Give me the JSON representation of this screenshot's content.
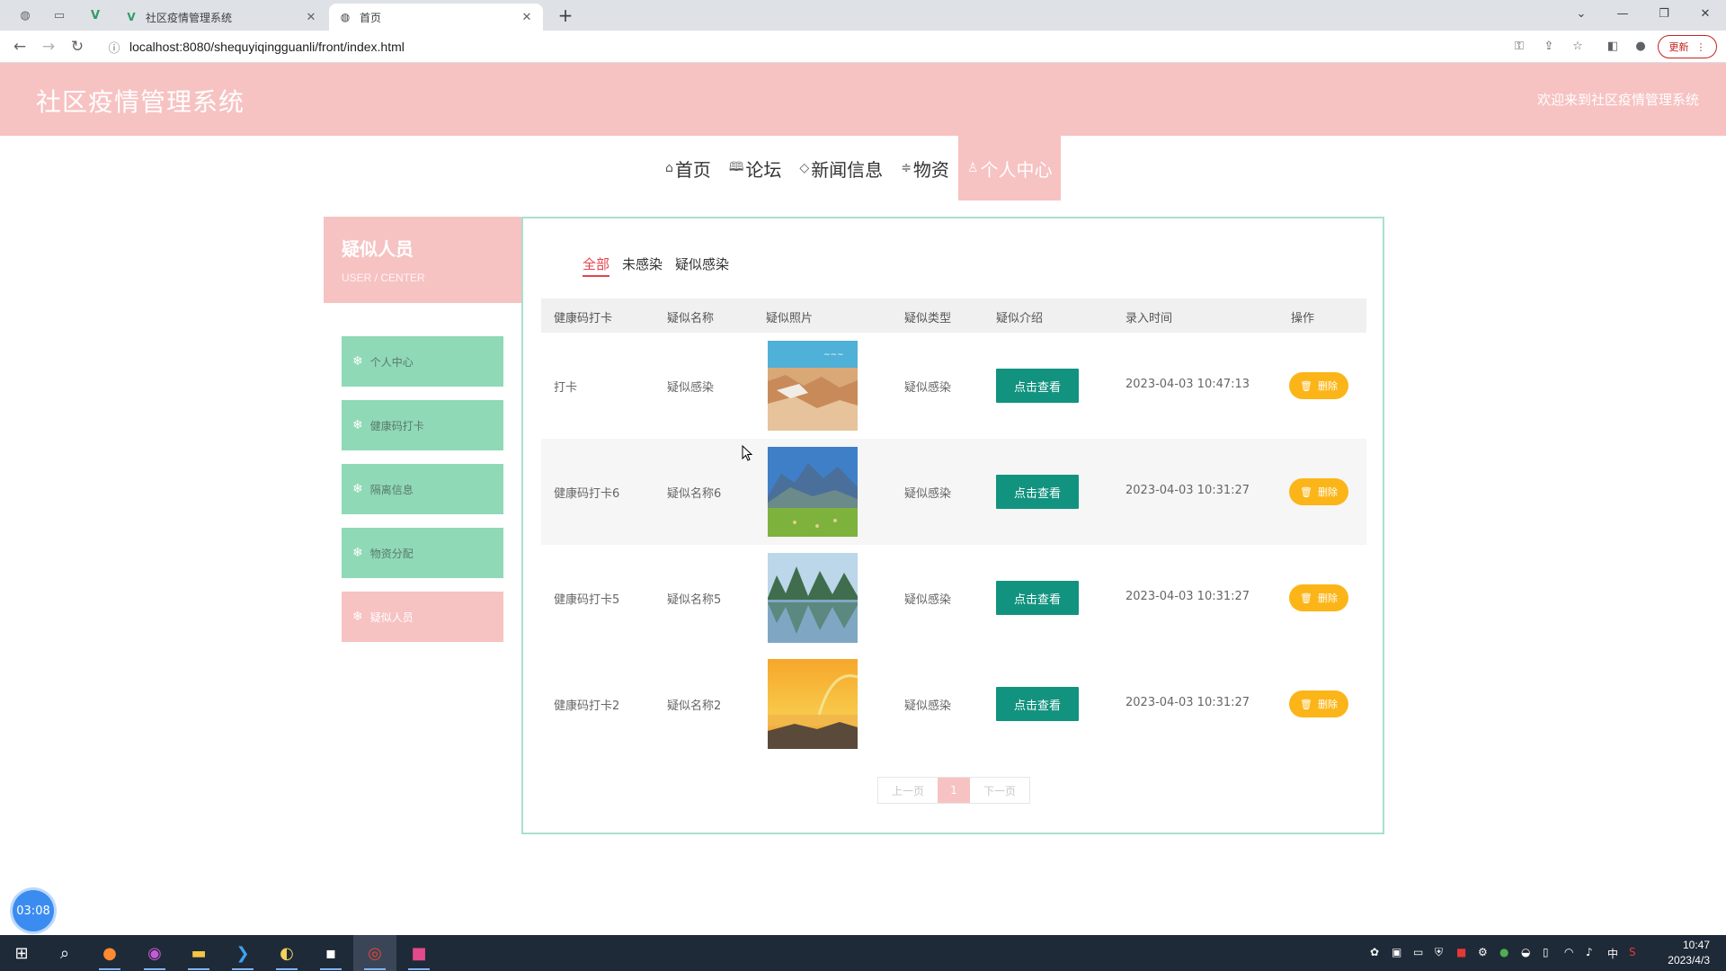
{
  "browser": {
    "tabs": [
      {
        "title": "社区疫情管理系统",
        "active": false
      },
      {
        "title": "首页",
        "active": true
      }
    ],
    "url": "localhost:8080/shequyiqingguanli/front/index.html",
    "update_label": "更新"
  },
  "site": {
    "title": "社区疫情管理系统",
    "welcome": "欢迎来到社区疫情管理系统"
  },
  "nav": [
    {
      "label": "首页",
      "icon": "home-icon",
      "active": false
    },
    {
      "label": "论坛",
      "icon": "book-icon",
      "active": false
    },
    {
      "label": "新闻信息",
      "icon": "tag-icon",
      "active": false
    },
    {
      "label": "物资",
      "icon": "sliders-icon",
      "active": false
    },
    {
      "label": "个人中心",
      "icon": "user-icon",
      "active": true
    }
  ],
  "sidebar": {
    "heading": "疑似人员",
    "subheading": "USER / CENTER",
    "items": [
      {
        "label": "个人中心",
        "active": false
      },
      {
        "label": "健康码打卡",
        "active": false
      },
      {
        "label": "隔离信息",
        "active": false
      },
      {
        "label": "物资分配",
        "active": false
      },
      {
        "label": "疑似人员",
        "active": true
      }
    ]
  },
  "filters": [
    "全部",
    "未感染",
    "疑似感染"
  ],
  "table": {
    "columns": [
      "健康码打卡",
      "疑似名称",
      "疑似照片",
      "疑似类型",
      "疑似介绍",
      "录入时间",
      "操作"
    ],
    "view_label": "点击查看",
    "delete_label": "删除",
    "rows": [
      {
        "checkin": "打卡",
        "name": "疑似感染",
        "photo": "desert-canyon-photo",
        "type": "疑似感染",
        "time": "2023-04-03 10:47:13"
      },
      {
        "checkin": "健康码打卡6",
        "name": "疑似名称6",
        "photo": "mountain-meadow-photo",
        "type": "疑似感染",
        "time": "2023-04-03 10:31:27"
      },
      {
        "checkin": "健康码打卡5",
        "name": "疑似名称5",
        "photo": "river-karst-photo",
        "type": "疑似感染",
        "time": "2023-04-03 10:31:27"
      },
      {
        "checkin": "健康码打卡2",
        "name": "疑似名称2",
        "photo": "sunset-rainbow-photo",
        "type": "疑似感染",
        "time": "2023-04-03 10:31:27"
      }
    ]
  },
  "pagination": {
    "prev": "上一页",
    "current": "1",
    "next": "下一页"
  },
  "timer_badge": "03:08",
  "taskbar": {
    "time": "10:47",
    "date": "2023/4/3",
    "ime": "中"
  },
  "colors": {
    "header_pink": "#f7c2c2",
    "sidebar_green": "#8fd9b6",
    "view_button_teal": "#12937f",
    "delete_button_yellow": "#fbb518",
    "filter_active_red": "#e5434b"
  }
}
